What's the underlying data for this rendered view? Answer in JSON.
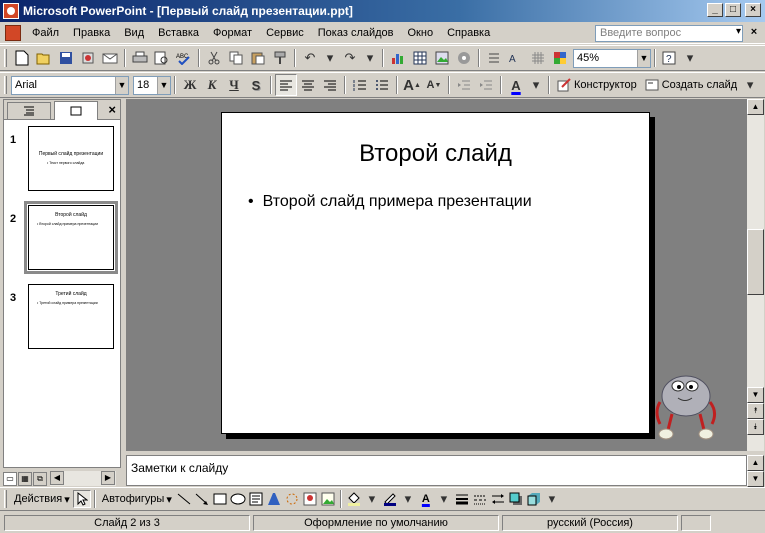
{
  "window": {
    "title": "Microsoft PowerPoint - [Первый слайд презентации.ppt]",
    "controls": [
      "_",
      "□",
      "×"
    ]
  },
  "menu": {
    "items": [
      "Файл",
      "Правка",
      "Вид",
      "Вставка",
      "Формат",
      "Сервис",
      "Показ слайдов",
      "Окно",
      "Справка"
    ],
    "help_placeholder": "Введите вопрос"
  },
  "standard_toolbar": {
    "zoom": "45%"
  },
  "format_toolbar": {
    "font": "Arial",
    "size": "18",
    "bold": "Ж",
    "italic": "К",
    "underline": "Ч",
    "shadow": "S",
    "designer": "Конструктор",
    "new_slide": "Создать слайд"
  },
  "outline_pane": {
    "close": "×",
    "slides": [
      {
        "number": "1",
        "title": "Первый слайд презентации",
        "body": "• Текст первого слайда"
      },
      {
        "number": "2",
        "title": "Второй слайд",
        "body": "• Второй слайд примера презентации"
      },
      {
        "number": "3",
        "title": "Третий слайд",
        "body": "• Третий слайд примера презентации"
      }
    ]
  },
  "slide": {
    "title": "Второй слайд",
    "bullet": "Второй слайд примера презентации"
  },
  "notes": {
    "placeholder": "Заметки к слайду"
  },
  "drawing_toolbar": {
    "actions": "Действия",
    "autoshapes": "Автофигуры"
  },
  "status": {
    "slide_position": "Слайд 2 из 3",
    "design": "Оформление по умолчанию",
    "language": "русский (Россия)"
  }
}
